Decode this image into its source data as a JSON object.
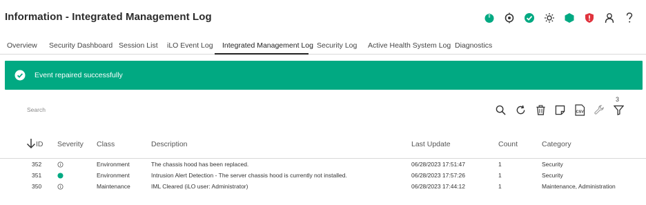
{
  "header": {
    "title": "Information - Integrated Management Log"
  },
  "status_icons": [
    {
      "name": "power-icon",
      "color": "#01a982"
    },
    {
      "name": "uid-icon",
      "color": "#333333"
    },
    {
      "name": "health-ok-icon",
      "color": "#01a982"
    },
    {
      "name": "brightness-icon",
      "color": "#333333"
    },
    {
      "name": "hexagon-status-icon",
      "color": "#01a982"
    },
    {
      "name": "security-shield-icon",
      "color": "#e0333d"
    },
    {
      "name": "user-icon",
      "color": "#333333"
    },
    {
      "name": "help-icon",
      "color": "#333333"
    }
  ],
  "tabs": [
    {
      "label": "Overview"
    },
    {
      "label": "Security Dashboard"
    },
    {
      "label": "Session List"
    },
    {
      "label": "iLO Event Log"
    },
    {
      "label": "Integrated Management Log"
    },
    {
      "label": "Security Log"
    },
    {
      "label": "Active Health System Log"
    },
    {
      "label": "Diagnostics"
    }
  ],
  "active_tab": "Integrated Management Log",
  "banner": {
    "message": "Event repaired successfully",
    "color": "#01a982"
  },
  "search": {
    "placeholder": "Search"
  },
  "toolbar": {
    "filter_count": "3",
    "icons": [
      "search-icon",
      "refresh-icon",
      "delete-icon",
      "note-icon",
      "csv-export-icon",
      "repair-wrench-icon",
      "filter-icon"
    ]
  },
  "table": {
    "columns": {
      "id": "ID",
      "severity": "Severity",
      "class": "Class",
      "description": "Description",
      "last_update": "Last Update",
      "count": "Count",
      "category": "Category"
    },
    "sort": "descending",
    "rows": [
      {
        "id": "352",
        "severity": "informational",
        "class": "Environment",
        "description": "The chassis hood has been replaced.",
        "last_update": "06/28/2023 17:51:47",
        "count": "1",
        "category": "Security"
      },
      {
        "id": "351",
        "severity": "repaired",
        "class": "Environment",
        "description": "Intrusion Alert Detection - The server chassis hood is currently not installed.",
        "last_update": "06/28/2023 17:57:26",
        "count": "1",
        "category": "Security"
      },
      {
        "id": "350",
        "severity": "informational",
        "class": "Maintenance",
        "description": "IML Cleared (iLO user: Administrator)",
        "last_update": "06/28/2023 17:44:12",
        "count": "1",
        "category": "Maintenance, Administration"
      }
    ]
  }
}
